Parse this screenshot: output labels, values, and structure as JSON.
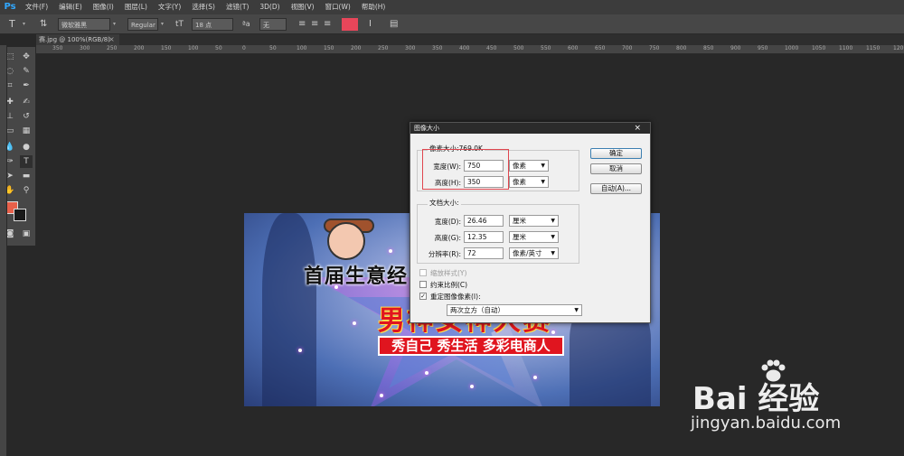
{
  "app": {
    "logo": "Ps",
    "menu": [
      "文件(F)",
      "编辑(E)",
      "图像(I)",
      "图层(L)",
      "文字(Y)",
      "选择(S)",
      "滤镜(T)",
      "3D(D)",
      "视图(V)",
      "窗口(W)",
      "帮助(H)"
    ]
  },
  "options_bar": {
    "font_family": "微软雅黑",
    "font_style": "Regular",
    "font_size": "18 点",
    "aa_mode": "无",
    "text_color": "#e8465a"
  },
  "document": {
    "tab_title": "赛.jpg @ 100%(RGB/8)",
    "ruler_ticks": [
      "350",
      "300",
      "250",
      "200",
      "150",
      "100",
      "50",
      "0",
      "50",
      "100",
      "150",
      "200",
      "250",
      "300",
      "350",
      "400",
      "450",
      "500",
      "550",
      "600",
      "650",
      "700",
      "750",
      "800",
      "850",
      "900",
      "950",
      "1000",
      "1050",
      "1100",
      "1150",
      "1200"
    ]
  },
  "canvas": {
    "banner_title": "首届生意经",
    "banner_big": "男神女神大赛",
    "banner_ribbon": "秀自己 秀生活 多彩电商人"
  },
  "dialog": {
    "title": "图像大小",
    "pixel_group_label": "像素大小:769.0K",
    "width_label": "宽度(W):",
    "width_value": "750",
    "width_unit": "像素",
    "height_label": "高度(H):",
    "height_value": "350",
    "height_unit": "像素",
    "doc_group_label": "文档大小:",
    "doc_width_label": "宽度(D):",
    "doc_width_value": "26.46",
    "doc_width_unit": "厘米",
    "doc_height_label": "高度(G):",
    "doc_height_value": "12.35",
    "doc_height_unit": "厘米",
    "resolution_label": "分辨率(R):",
    "resolution_value": "72",
    "resolution_unit": "像素/英寸",
    "scale_styles_label": "缩放样式(Y)",
    "constrain_label": "约束比例(C)",
    "resample_label": "重定图像像素(I):",
    "resample_checked": true,
    "resample_method": "两次立方（自动）",
    "ok_label": "确定",
    "cancel_label": "取消",
    "auto_label": "自动(A)..."
  },
  "watermark": {
    "brand": "Bai 经验",
    "url": "jingyan.baidu.com"
  }
}
